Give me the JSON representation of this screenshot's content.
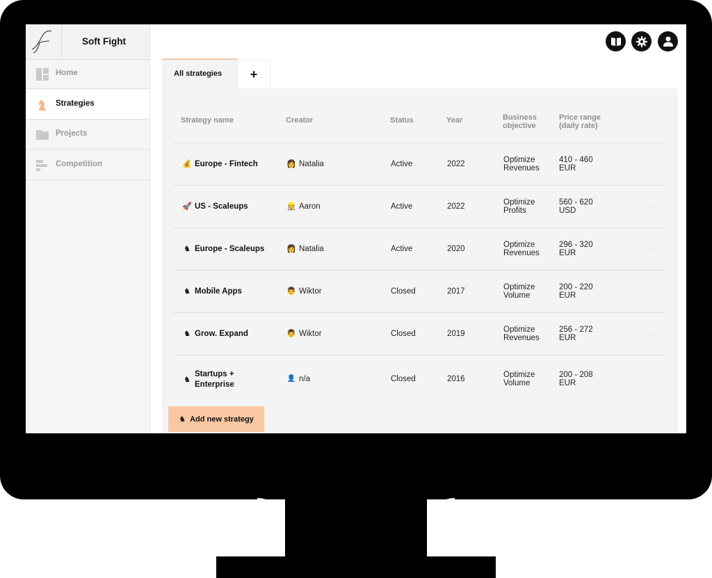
{
  "app": {
    "name": "Soft Fight"
  },
  "sidebar": {
    "items": [
      {
        "label": "Home",
        "icon": "dashboard-icon",
        "active": false
      },
      {
        "label": "Strategies",
        "icon": "chess-knight-icon",
        "active": true
      },
      {
        "label": "Projects",
        "icon": "folder-icon",
        "active": false
      },
      {
        "label": "Competition",
        "icon": "bars-icon",
        "active": false
      }
    ]
  },
  "header": {
    "icons": [
      "book-icon",
      "gear-icon",
      "user-icon"
    ]
  },
  "tabs": [
    {
      "label": "All strategies",
      "active": true
    },
    {
      "label": "+",
      "active": false
    }
  ],
  "table": {
    "headers": {
      "name": "Strategy name",
      "creator": "Creator",
      "status": "Status",
      "year": "Year",
      "objective": [
        "Business",
        "objective"
      ],
      "price": [
        "Price range",
        "(daily rate)"
      ]
    },
    "rows": [
      {
        "emoji": "💰",
        "name": [
          "Europe - Fintech"
        ],
        "creator_emoji": "👩",
        "creator": "Natalia",
        "status": "Active",
        "year": "2022",
        "objective": [
          "Optimize",
          "Revenues"
        ],
        "price": [
          "410 - 460",
          "EUR"
        ],
        "more": "···"
      },
      {
        "emoji": "🚀",
        "name": [
          "US - Scaleups"
        ],
        "creator_emoji": "👷",
        "creator": "Aaron",
        "status": "Active",
        "year": "2022",
        "objective": [
          "Optimize",
          "Profits"
        ],
        "price": [
          "560 - 620",
          "USD"
        ],
        "more": "···"
      },
      {
        "emoji": "♞",
        "name": [
          "Europe - Scaleups"
        ],
        "creator_emoji": "👩",
        "creator": "Natalia",
        "status": "Active",
        "year": "2020",
        "objective": [
          "Optimize",
          "Revenues"
        ],
        "price": [
          "296 - 320",
          "EUR"
        ],
        "more": "···"
      },
      {
        "emoji": "♞",
        "name": [
          "Mobile Apps"
        ],
        "creator_emoji": "👨",
        "creator": "Wiktor",
        "status": "Closed",
        "year": "2017",
        "objective": [
          "Optimize",
          "Volume"
        ],
        "price": [
          "200 - 220",
          "EUR"
        ],
        "more": "···"
      },
      {
        "emoji": "♞",
        "name": [
          "Grow. Expand"
        ],
        "creator_emoji": "👨",
        "creator": "Wiktor",
        "status": "Closed",
        "year": "2019",
        "objective": [
          "Optimize",
          "Revenues"
        ],
        "price": [
          "256 - 272",
          "EUR"
        ],
        "more": "···"
      },
      {
        "emoji": "♞",
        "name": [
          "Startups +",
          "Enterprise"
        ],
        "creator_emoji": "👤",
        "creator": "n/a",
        "status": "Closed",
        "year": "2016",
        "objective": [
          "Optimize",
          "Volume"
        ],
        "price": [
          "200 - 208",
          "EUR"
        ],
        "more": "···"
      }
    ]
  },
  "add_button": {
    "label": "Add new strategy",
    "emoji": "♞"
  },
  "colors": {
    "accent": "#f9c8a3",
    "active_tab_border": "#f4c9a8",
    "panel": "#f4f4f4",
    "frame": "#000000"
  }
}
